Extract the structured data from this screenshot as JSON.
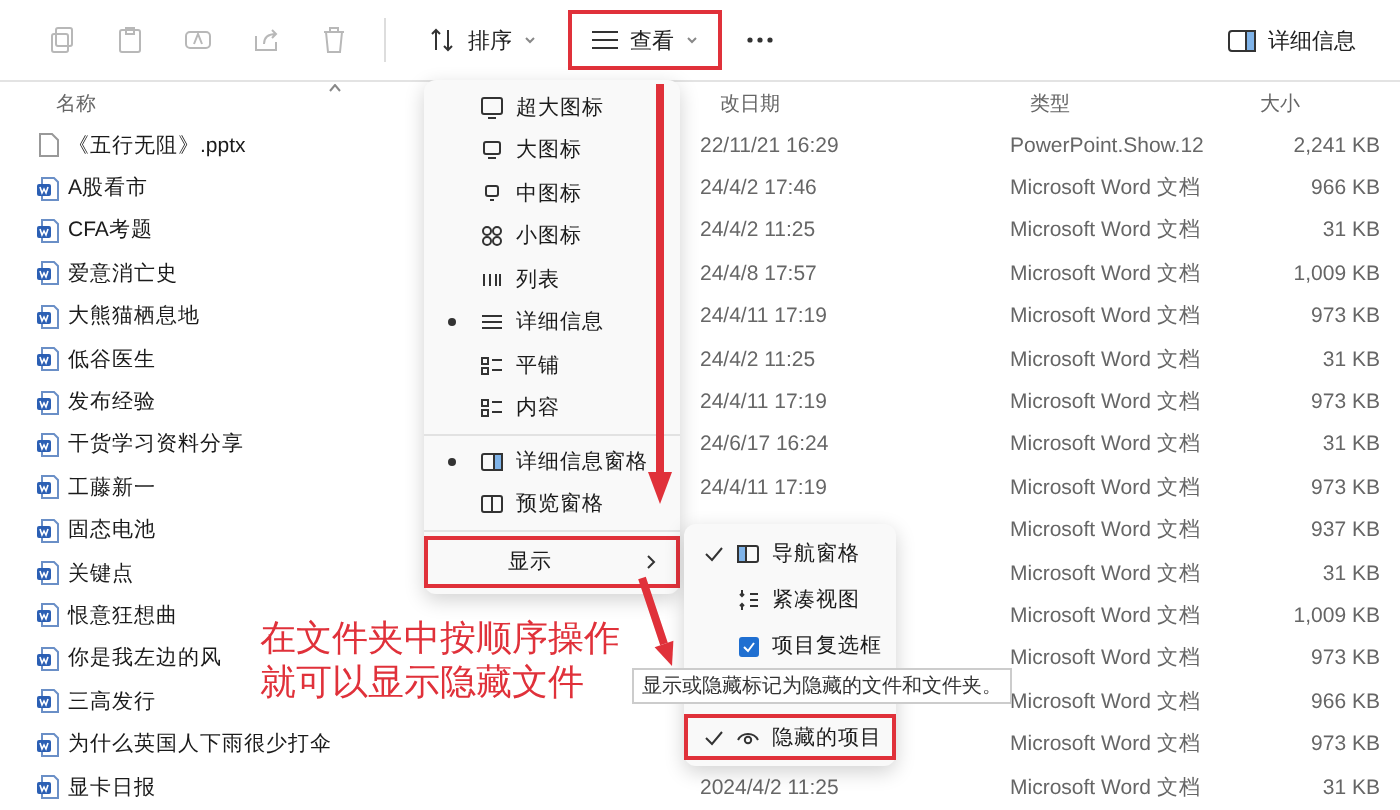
{
  "toolbar": {
    "icon_buttons": [
      {
        "kind": "copy",
        "disabled": true
      },
      {
        "kind": "paste",
        "disabled": true
      },
      {
        "kind": "rename",
        "disabled": true
      },
      {
        "kind": "share",
        "disabled": true
      },
      {
        "kind": "delete",
        "disabled": true
      }
    ],
    "sort": {
      "label": "排序"
    },
    "view": {
      "label": "查看",
      "annotated": true
    },
    "details_pane": {
      "label": "详细信息"
    }
  },
  "columns": [
    "名称",
    "改日期",
    "类型",
    "大小"
  ],
  "rows": [
    {
      "name": "《五行无阻》.pptx",
      "kind": "pptx",
      "modified": "22/11/21 16:29",
      "type": "PowerPoint.Show.12",
      "size": "2,241 KB"
    },
    {
      "name": "A股看市",
      "kind": "word",
      "modified": "24/4/2 17:46",
      "type": "Microsoft Word 文档",
      "size": "966 KB"
    },
    {
      "name": "CFA考题",
      "kind": "word",
      "modified": "24/4/2 11:25",
      "type": "Microsoft Word 文档",
      "size": "31 KB"
    },
    {
      "name": "爱意消亡史",
      "kind": "word",
      "modified": "24/4/8 17:57",
      "type": "Microsoft Word 文档",
      "size": "1,009 KB"
    },
    {
      "name": "大熊猫栖息地",
      "kind": "word",
      "modified": "24/4/11 17:19",
      "type": "Microsoft Word 文档",
      "size": "973 KB"
    },
    {
      "name": "低谷医生",
      "kind": "word",
      "modified": "24/4/2 11:25",
      "type": "Microsoft Word 文档",
      "size": "31 KB"
    },
    {
      "name": "发布经验",
      "kind": "word",
      "modified": "24/4/11 17:19",
      "type": "Microsoft Word 文档",
      "size": "973 KB"
    },
    {
      "name": "干货学习资料分享",
      "kind": "word",
      "modified": "24/6/17 16:24",
      "type": "Microsoft Word 文档",
      "size": "31 KB"
    },
    {
      "name": "工藤新一",
      "kind": "word",
      "modified": "24/4/11 17:19",
      "type": "Microsoft Word 文档",
      "size": "973 KB"
    },
    {
      "name": "固态电池",
      "kind": "word",
      "type": "Microsoft Word 文档",
      "size": "937 KB"
    },
    {
      "name": "关键点",
      "kind": "word",
      "type": "Microsoft Word 文档",
      "size": "31 KB"
    },
    {
      "name": "恨意狂想曲",
      "kind": "word",
      "type": "Microsoft Word 文档",
      "size": "1,009 KB"
    },
    {
      "name": "你是我左边的风",
      "kind": "word",
      "type": "Microsoft Word 文档",
      "size": "973 KB"
    },
    {
      "name": "三高发行",
      "kind": "word",
      "type": "Microsoft Word 文档",
      "size": "966 KB"
    },
    {
      "name": "为什么英国人下雨很少打伞",
      "kind": "word",
      "type": "Microsoft Word 文档",
      "size": "973 KB"
    },
    {
      "name": "显卡日报",
      "kind": "word",
      "modified": "2024/4/2 11:25",
      "type": "Microsoft Word 文档",
      "size": "31 KB"
    }
  ],
  "view_menu": {
    "groups": [
      [
        {
          "label": "超大图标",
          "kind": "xl",
          "selected": false
        },
        {
          "label": "大图标",
          "kind": "large",
          "selected": false
        },
        {
          "label": "中图标",
          "kind": "medium",
          "selected": false
        },
        {
          "label": "小图标",
          "kind": "small",
          "selected": false
        },
        {
          "label": "列表",
          "kind": "list",
          "selected": false
        },
        {
          "label": "详细信息",
          "kind": "details",
          "selected": true
        },
        {
          "label": "平铺",
          "kind": "tiles",
          "selected": false
        },
        {
          "label": "内容",
          "kind": "content",
          "selected": false
        }
      ],
      [
        {
          "label": "详细信息窗格",
          "kind": "detailspane",
          "selected": true
        },
        {
          "label": "预览窗格",
          "kind": "previewpane",
          "selected": false
        }
      ]
    ],
    "show": {
      "label": "显示",
      "annotated": true
    }
  },
  "show_menu": {
    "items": [
      {
        "label": "导航窗格",
        "kind": "navpane",
        "checked": true
      },
      {
        "label": "紧凑视图",
        "kind": "compact",
        "checked": false
      },
      {
        "label": "项目复选框",
        "kind": "checkboxes",
        "checked": false
      },
      {
        "kind": "covered"
      },
      {
        "label": "隐藏的项目",
        "kind": "hidden",
        "checked": true,
        "annotated": true
      }
    ],
    "tooltip": "显示或隐藏标记为隐藏的文件和文件夹。"
  },
  "annotation": {
    "lines": [
      "在文件夹中按顺序操作",
      "就可以显示隐藏文件"
    ]
  }
}
